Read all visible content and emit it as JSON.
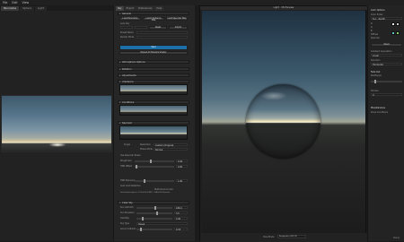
{
  "menu": [
    "File",
    "Edit",
    "View"
  ],
  "left_tabs": [
    "Panorama",
    "Sphere",
    "Light"
  ],
  "mid_tabs": [
    "Sky",
    "Export",
    "Preferences",
    "Help"
  ],
  "sections": {
    "general": "General",
    "atmosphere": "Atmosphere Options",
    "rotation": "Rotation",
    "adjustments": "Adjustments",
    "irradiance": "Irradiance",
    "conditions": "Conditions",
    "specular": "Specular",
    "clear_sky": "Clear Sky"
  },
  "general": {
    "buttons": [
      "Load Panorama",
      "Load Irradiance Map",
      "Load Specular Map"
    ],
    "row_label": "Auto Sky",
    "row_buttons": [
      "Reset",
      "Import"
    ],
    "preset_label": "Preset Name",
    "render_label": "Render Mode",
    "save_button": "Save",
    "reload_button": "Reload All Shaders Shader"
  },
  "specular": {
    "single_label": "Single",
    "resolution_label": "Resolution",
    "resolution_value": "Custom (Original)",
    "phase_label": "Phase Mode",
    "phase_value": "Normal",
    "checkbox_label": "Use Specular Power",
    "roughness_label": "Roughness",
    "roughness_value": "0.40",
    "offset_label": "HDR Offset",
    "offset_value": "0.00",
    "hdr_label": "HDR Exposure",
    "hdr_value": "1.00",
    "note_left": "Auto Grid Detection",
    "note_right": "Multi-bounce Lock",
    "info": "Total baked sphere: 512x256 (HDR) · 2048x1024 pixels"
  },
  "clear_sky": {
    "rows": [
      {
        "label": "Sun Azimuth",
        "value": "180.0"
      },
      {
        "label": "Sun Elevation",
        "value": "3.5"
      },
      {
        "label": "Turbidity",
        "value": "2.00"
      },
      {
        "label": "Sky Type",
        "value": "Hosek"
      },
      {
        "label": "Ground Albedo",
        "value": "0.10"
      }
    ]
  },
  "viewport": {
    "title": "Light · 3D Preview",
    "mode_label": "View Mode",
    "mode_value": "Perspective (3D) (F)"
  },
  "right": {
    "title": "Color Options",
    "picker_label": "Color Picker",
    "picker_value": "Sun · Zenith",
    "rows": [
      "R",
      "G",
      "B",
      "Diffuse",
      "Specular"
    ],
    "reset": "Reset",
    "gradient_label": "Gradient Generation",
    "gradient_value": "Linear",
    "section_label": "Direction",
    "section_value": "Horizontal",
    "fade_title": "Fade Out",
    "fade_sub": "Rooftop(s)",
    "horizon_label": "Horizon",
    "horizon_value": "0",
    "bottom_title": "Miscellaneous",
    "checkbox": "Show Conditions",
    "status": "Ready"
  },
  "colors": {
    "accent": "#1e6fa8",
    "sky_top": "#3e596b",
    "horizon": "#f2ebcc",
    "swatch_1": "#f2f2f2",
    "swatch_2": "#c8c8c8",
    "swatch_3": "#69c4c4",
    "swatch_4": "#8ad06a"
  }
}
